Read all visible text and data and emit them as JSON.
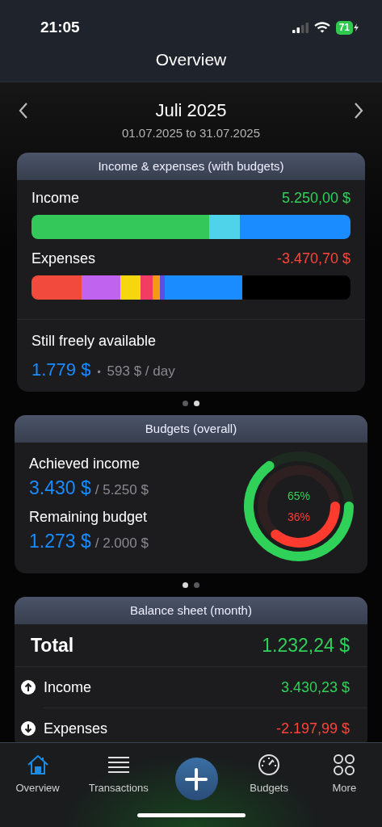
{
  "status_bar": {
    "time": "21:05",
    "battery": "71"
  },
  "window": {
    "title": "Overview"
  },
  "period": {
    "title": "Juli 2025",
    "range": "01.07.2025 to 31.07.2025"
  },
  "income_expenses": {
    "title": "Income & expenses (with budgets)",
    "income": {
      "label": "Income",
      "amount": "5.250,00 $",
      "segments": [
        {
          "color": "#34c759"
        },
        {
          "color": "#4fd3ea"
        },
        {
          "color": "#1a8cff"
        }
      ]
    },
    "expenses": {
      "label": "Expenses",
      "amount": "-3.470,70 $",
      "segments": [
        {
          "color": "#f24a3d"
        },
        {
          "color": "#c064f0"
        },
        {
          "color": "#f5d60f"
        },
        {
          "color": "#f23d63"
        },
        {
          "color": "#f59a12"
        },
        {
          "color": "#5a4fe0"
        },
        {
          "color": "#1a8cff"
        }
      ]
    },
    "free_label": "Still freely available",
    "free_amount": "1.779 $",
    "separator": "•",
    "per_day": "593 $ / day",
    "pager": [
      {
        "selected": false
      },
      {
        "selected": true
      }
    ]
  },
  "budgets": {
    "title": "Budgets (overall)",
    "rows": [
      {
        "label": "Achieved income",
        "value": "3.430 $",
        "of": "/ 5.250 $"
      },
      {
        "label": "Remaining budget",
        "value": "1.273 $",
        "of": "/ 2.000 $"
      }
    ],
    "rings": [
      {
        "percent": "65%",
        "color": "#30d158"
      },
      {
        "percent": "36%",
        "color": "#ff3b30"
      }
    ],
    "pager": [
      {
        "selected": true
      },
      {
        "selected": false
      }
    ]
  },
  "balance": {
    "title": "Balance sheet (month)",
    "rows": [
      {
        "kind": "total",
        "label": "Total",
        "amount": "1.232,24 $",
        "color": "#30d158"
      },
      {
        "kind": "up",
        "label": "Income",
        "amount": "3.430,23 $",
        "color": "#30d158"
      },
      {
        "kind": "down",
        "label": "Expenses",
        "amount": "-2.197,99 $",
        "color": "#ff453a"
      }
    ]
  },
  "tabs": [
    {
      "kind": "home",
      "label": "Overview",
      "selected": true
    },
    {
      "kind": "list",
      "label": "Transactions",
      "selected": false
    },
    {
      "kind": "add",
      "selected": false
    },
    {
      "kind": "gauge",
      "label": "Budgets",
      "selected": false
    },
    {
      "kind": "grid",
      "label": "More",
      "selected": false
    }
  ]
}
